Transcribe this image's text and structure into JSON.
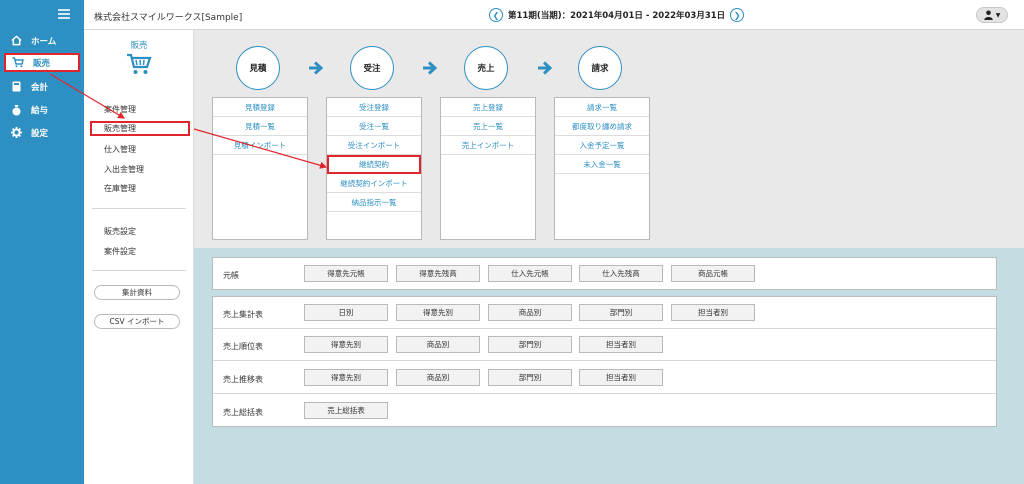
{
  "header": {
    "company": "株式会社スマイルワークス[Sample]",
    "period": "第11期(当期)：2021年04月01日 - 2022年03月31日"
  },
  "leftnav": {
    "items": [
      {
        "label": "ホーム",
        "icon": "home-icon"
      },
      {
        "label": "販売",
        "icon": "cart-icon"
      },
      {
        "label": "会計",
        "icon": "calculator-icon"
      },
      {
        "label": "給与",
        "icon": "money-bag-icon"
      },
      {
        "label": "設定",
        "icon": "gear-icon"
      }
    ]
  },
  "submenu": {
    "title": "販売",
    "links": [
      "案件管理",
      "販売管理",
      "仕入管理",
      "入出金管理",
      "在庫管理"
    ],
    "settings": [
      "販売設定",
      "案件設定"
    ],
    "pills": [
      "集計資料",
      "CSV インポート"
    ]
  },
  "workflow": {
    "steps": [
      {
        "label": "見積",
        "links": [
          "見積登録",
          "見積一覧",
          "見積インポート"
        ]
      },
      {
        "label": "受注",
        "links": [
          "受注登録",
          "受注一覧",
          "受注インポート",
          "継続契約",
          "継続契約インポート",
          "納品指示一覧"
        ]
      },
      {
        "label": "売上",
        "links": [
          "売上登録",
          "売上一覧",
          "売上インポート"
        ]
      },
      {
        "label": "請求",
        "links": [
          "請求一覧",
          "都度取り纏め請求",
          "入金予定一覧",
          "未入金一覧"
        ]
      }
    ]
  },
  "reports": {
    "ledger": {
      "label": "元帳",
      "buttons": [
        "得意先元帳",
        "得意先残高",
        "仕入先元帳",
        "仕入先残高",
        "商品元帳"
      ]
    },
    "rows": [
      {
        "label": "売上集計表",
        "buttons": [
          "日別",
          "得意先別",
          "商品別",
          "部門別",
          "担当者別"
        ]
      },
      {
        "label": "売上順位表",
        "buttons": [
          "得意先別",
          "商品別",
          "部門別",
          "担当者別"
        ]
      },
      {
        "label": "売上推移表",
        "buttons": [
          "得意先別",
          "商品別",
          "部門別",
          "担当者別"
        ]
      },
      {
        "label": "売上総括表",
        "buttons": [
          "売上総括表"
        ]
      }
    ]
  },
  "colors": {
    "accent": "#2e8fc3",
    "highlight": "#e0262d",
    "reports_bg": "#c3dde2"
  }
}
